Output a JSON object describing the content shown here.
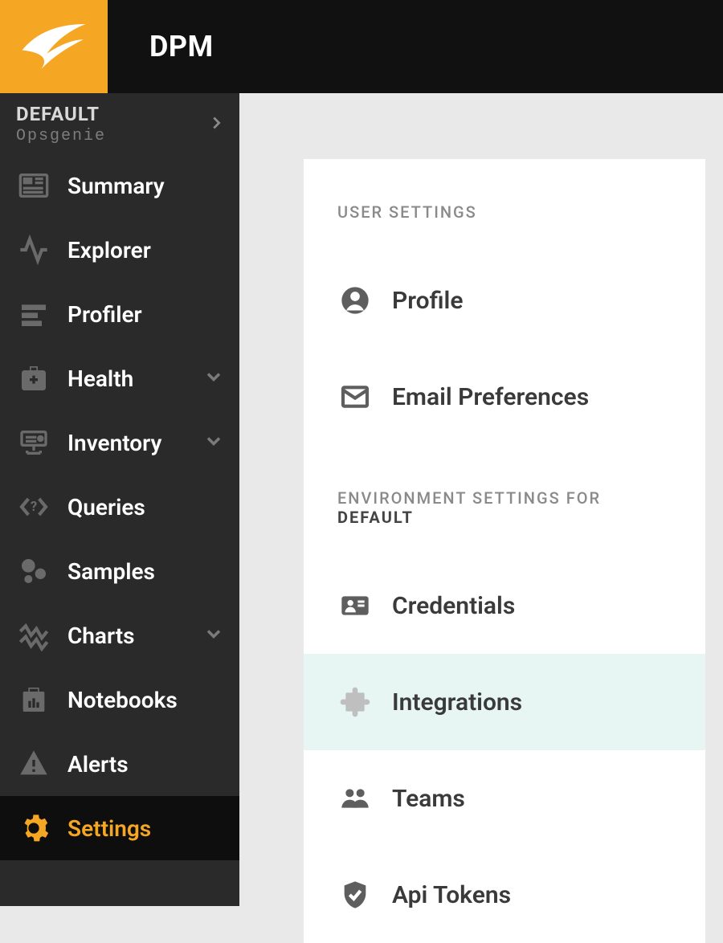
{
  "header": {
    "app_title": "DPM"
  },
  "env": {
    "name": "DEFAULT",
    "subtitle": "Opsgenie"
  },
  "sidebar": {
    "items": [
      {
        "label": "Summary",
        "expandable": false
      },
      {
        "label": "Explorer",
        "expandable": false
      },
      {
        "label": "Profiler",
        "expandable": false
      },
      {
        "label": "Health",
        "expandable": true
      },
      {
        "label": "Inventory",
        "expandable": true
      },
      {
        "label": "Queries",
        "expandable": false
      },
      {
        "label": "Samples",
        "expandable": false
      },
      {
        "label": "Charts",
        "expandable": true
      },
      {
        "label": "Notebooks",
        "expandable": false
      },
      {
        "label": "Alerts",
        "expandable": false
      },
      {
        "label": "Settings",
        "expandable": false
      }
    ],
    "active_index": 10
  },
  "settings": {
    "user_section_title": "USER SETTINGS",
    "env_section_title_prefix": "ENVIRONMENT SETTINGS FOR",
    "env_section_title_env": "DEFAULT",
    "user_items": [
      {
        "label": "Profile"
      },
      {
        "label": "Email Preferences"
      }
    ],
    "env_items": [
      {
        "label": "Credentials"
      },
      {
        "label": "Integrations"
      },
      {
        "label": "Teams"
      },
      {
        "label": "Api Tokens"
      }
    ],
    "selected_env_index": 1
  }
}
